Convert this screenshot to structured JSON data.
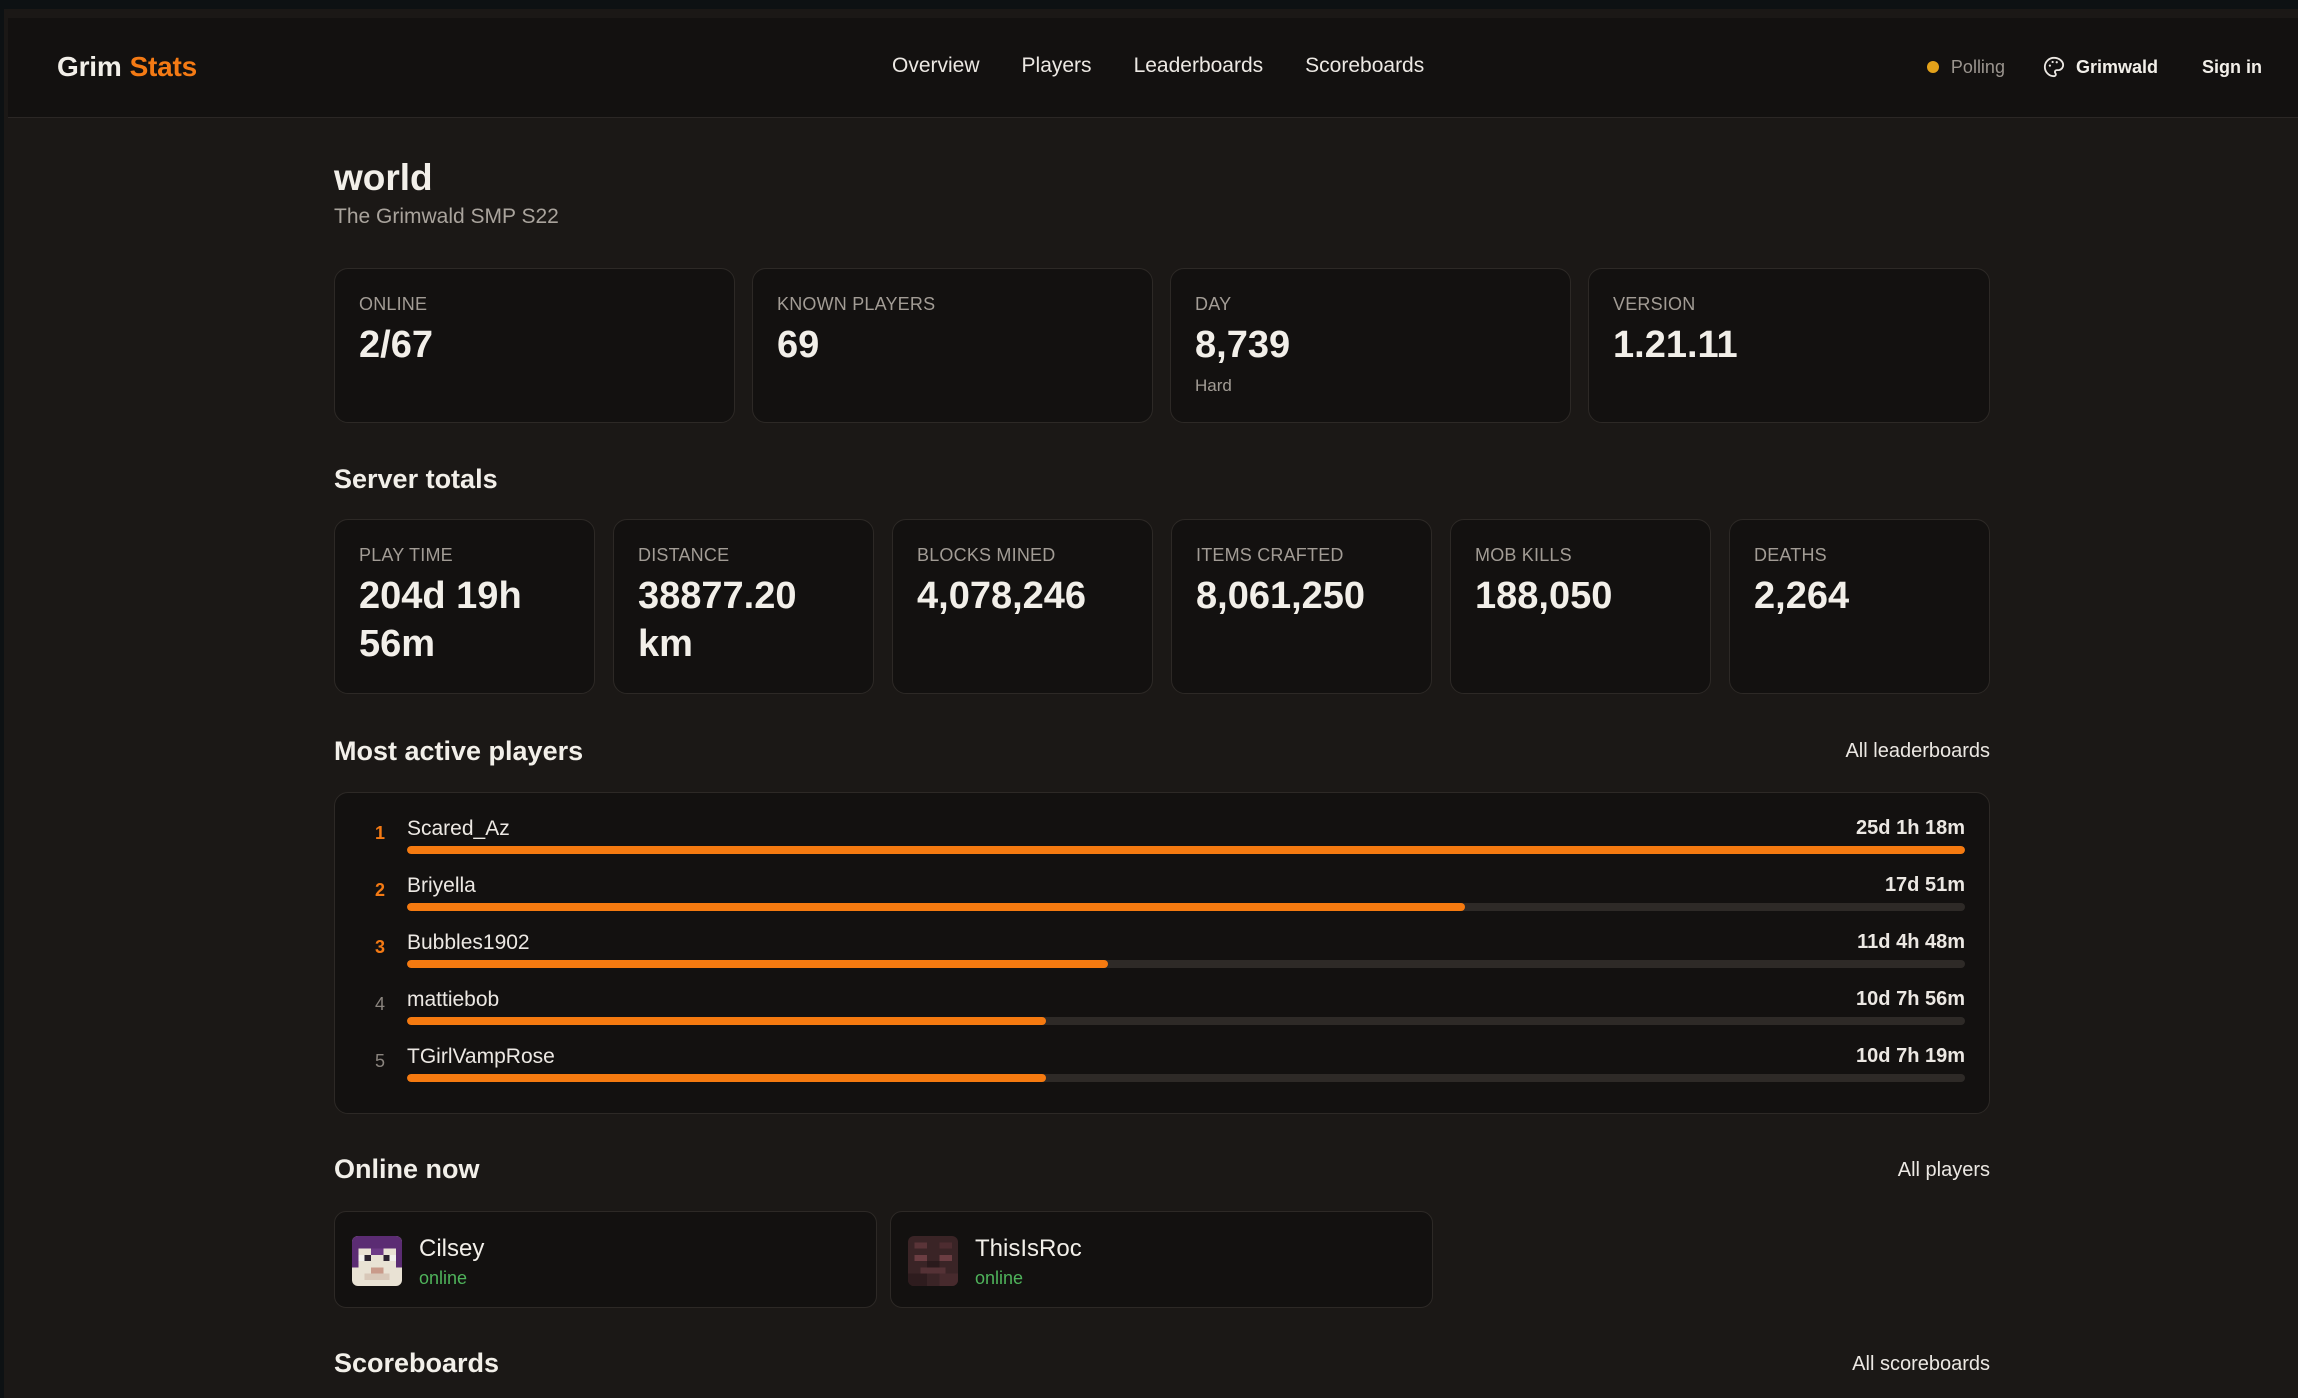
{
  "brand": {
    "part1": "Grim",
    "part2": "Stats"
  },
  "nav": [
    "Overview",
    "Players",
    "Leaderboards",
    "Scoreboards"
  ],
  "status": {
    "polling_label": "Polling",
    "server_name": "Grimwald",
    "sign_in": "Sign in"
  },
  "colors": {
    "accent": "#f47a14",
    "online": "#4fb35b",
    "polling": "#e4a21a"
  },
  "world": {
    "title": "world",
    "subtitle": "The Grimwald SMP S22"
  },
  "top_stats": [
    {
      "label": "ONLINE",
      "value": "2/67",
      "sub": ""
    },
    {
      "label": "KNOWN PLAYERS",
      "value": "69",
      "sub": ""
    },
    {
      "label": "DAY",
      "value": "8,739",
      "sub": "Hard"
    },
    {
      "label": "VERSION",
      "value": "1.21.11",
      "sub": ""
    }
  ],
  "server_totals": {
    "title": "Server totals",
    "items": [
      {
        "label": "PLAY TIME",
        "value_line1": "204d 19h",
        "value_line2": "56m"
      },
      {
        "label": "DISTANCE",
        "value_line1": "38877.20",
        "value_line2": "km"
      },
      {
        "label": "BLOCKS MINED",
        "value_line1": "4,078,246",
        "value_line2": ""
      },
      {
        "label": "ITEMS CRAFTED",
        "value_line1": "8,061,250",
        "value_line2": ""
      },
      {
        "label": "MOB KILLS",
        "value_line1": "188,050",
        "value_line2": ""
      },
      {
        "label": "DEATHS",
        "value_line1": "2,264",
        "value_line2": ""
      }
    ]
  },
  "most_active": {
    "title": "Most active players",
    "link": "All leaderboards",
    "players": [
      {
        "rank": "1",
        "name": "Scared_Az",
        "time": "25d 1h 18m",
        "progress": 1.0
      },
      {
        "rank": "2",
        "name": "Briyella",
        "time": "17d 51m",
        "progress": 0.679
      },
      {
        "rank": "3",
        "name": "Bubbles1902",
        "time": "11d 4h 48m",
        "progress": 0.45
      },
      {
        "rank": "4",
        "name": "mattiebob",
        "time": "10d 7h 56m",
        "progress": 0.41
      },
      {
        "rank": "5",
        "name": "TGirlVampRose",
        "time": "10d 7h 19m",
        "progress": 0.41
      }
    ]
  },
  "online_now": {
    "title": "Online now",
    "link": "All players",
    "players": [
      {
        "name": "Cilsey",
        "status": "online"
      },
      {
        "name": "ThisIsRoc",
        "status": "online"
      }
    ]
  },
  "scoreboards": {
    "title": "Scoreboards",
    "link": "All scoreboards"
  }
}
